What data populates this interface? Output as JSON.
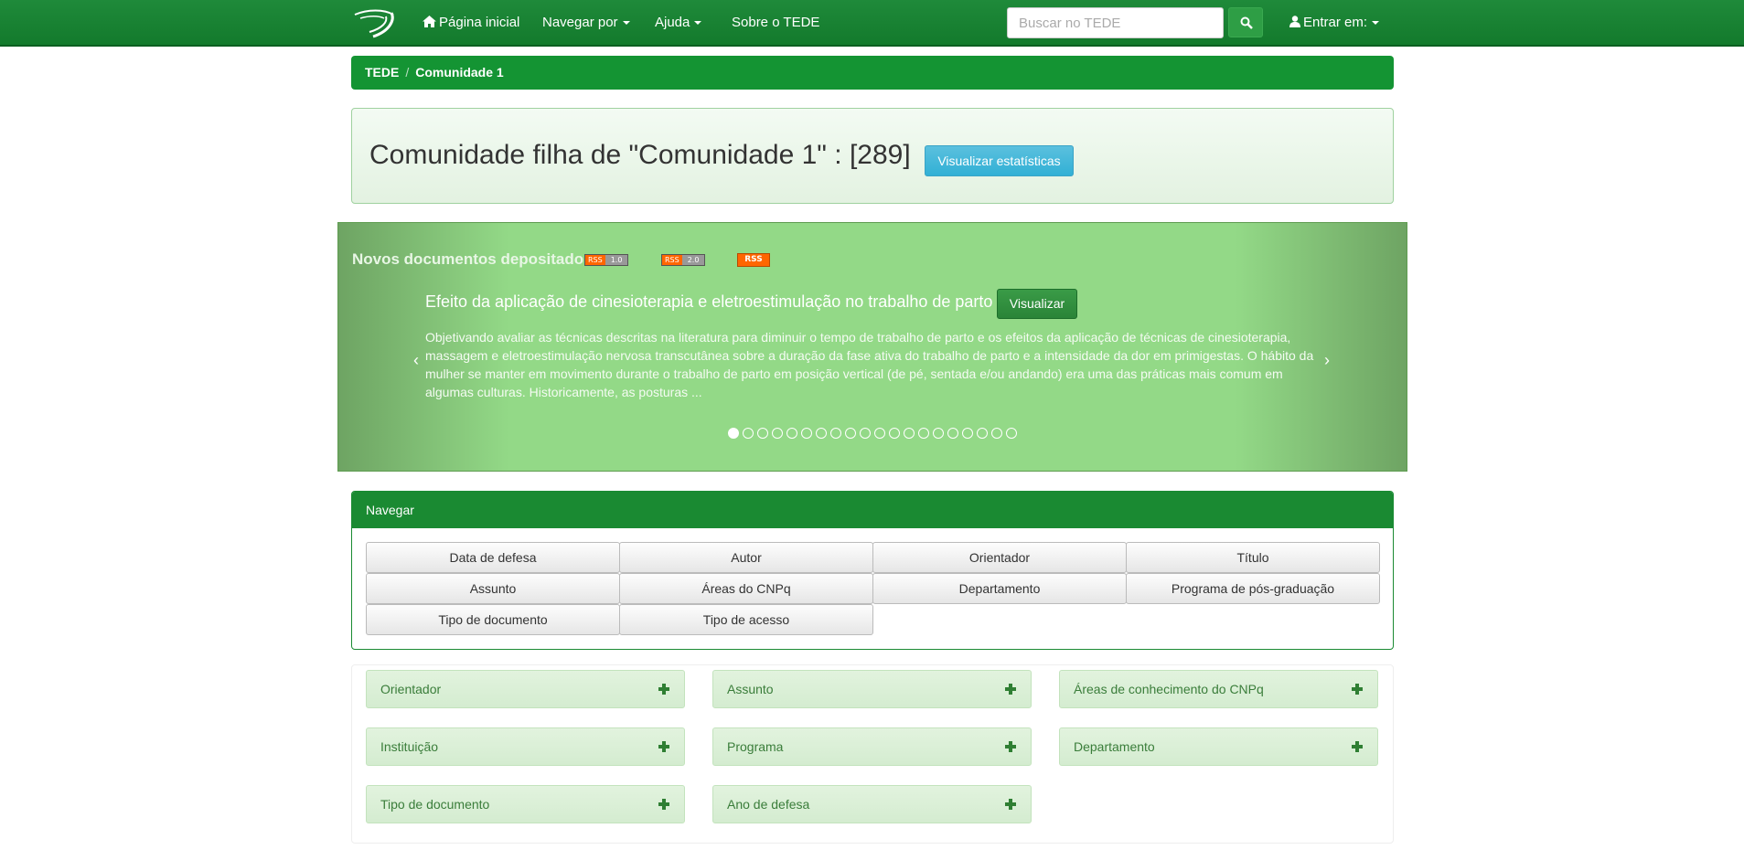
{
  "navbar": {
    "home_label": "Página inicial",
    "browse_label": "Navegar por",
    "help_label": "Ajuda",
    "about_label": "Sobre o TEDE",
    "search_placeholder": "Buscar no TEDE",
    "login_label": "Entrar em:",
    "icons": {
      "home": "home-icon",
      "search": "search-icon",
      "user": "user-icon",
      "caret": "caret-down-icon"
    }
  },
  "breadcrumb": {
    "root": "TEDE",
    "separator": "/",
    "current": "Comunidade 1"
  },
  "header": {
    "title": "Comunidade filha de \"Comunidade 1\" : [289]",
    "stats_button": "Visualizar estatísticas"
  },
  "carousel": {
    "heading": "Novos documentos depositados",
    "rss_badges": [
      {
        "left": "RSS",
        "right": "1.0"
      },
      {
        "left": "RSS",
        "right": "2.0"
      }
    ],
    "rss_plain": "RSS",
    "item_title": "Efeito da aplicação de cinesioterapia e eletroestimulação no trabalho de parto",
    "view_button": "Visualizar",
    "item_description": "Objetivando avaliar as técnicas descritas na literatura para diminuir o tempo de trabalho de parto e os efeitos da aplicação de técnicas de cinesioterapia, massagem e eletroestimulação nervosa transcutânea sobre a duração da fase ativa do trabalho de parto e a intensidade da dor em primigestas. O hábito da mulher se manter em movimento durante o trabalho de parto em posição vertical (de pé, sentada e/ou andando) era uma das práticas mais comum em algumas culturas. Historicamente, as posturas ...",
    "prev_arrow": "‹",
    "next_arrow": "›",
    "indicator_count": 20,
    "active_indicator": 0
  },
  "browse_panel": {
    "heading": "Navegar",
    "buttons": [
      "Data de defesa",
      "Autor",
      "Orientador",
      "Título",
      "Assunto",
      "Áreas do CNPq",
      "Departamento",
      "Programa de pós-graduação",
      "Tipo de documento",
      "Tipo de acesso"
    ]
  },
  "facets": [
    "Orientador",
    "Assunto",
    "Áreas de conhecimento do CNPq",
    "Instituição",
    "Programa",
    "Departamento",
    "Tipo de documento",
    "Ano de defesa"
  ],
  "colors": {
    "brand_green": "#137a2c",
    "panel_green": "#1a8a32",
    "info_blue": "#31b0d5"
  }
}
